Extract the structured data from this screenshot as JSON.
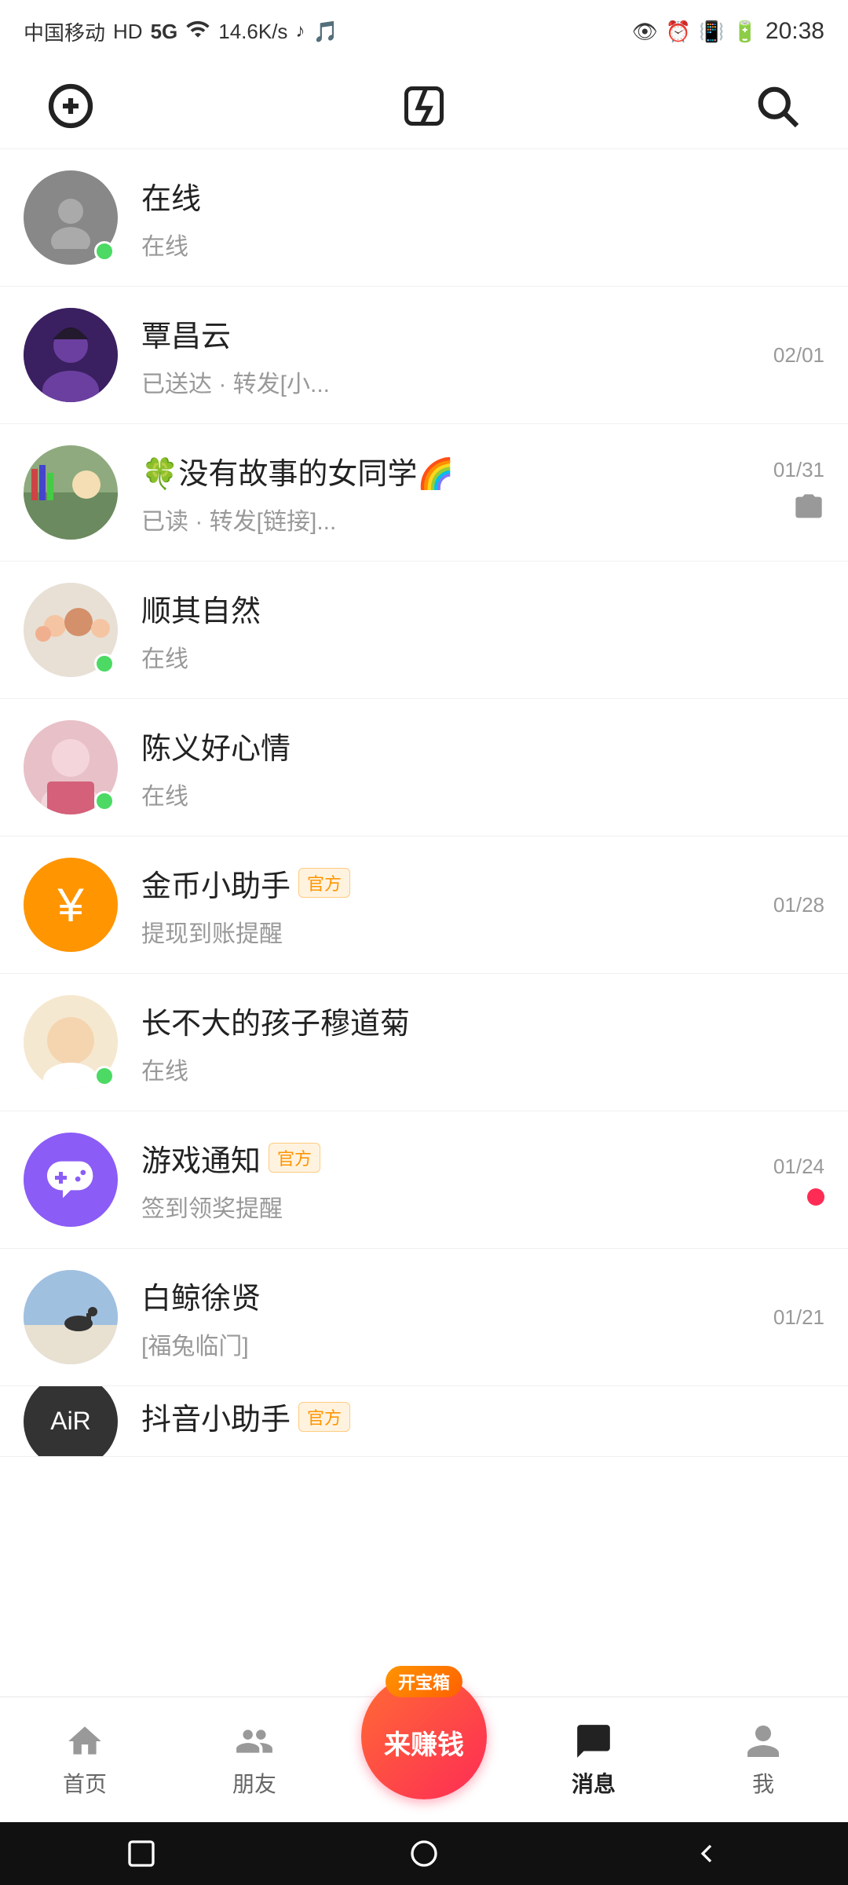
{
  "statusBar": {
    "carrier": "中国移动",
    "networkType": "HD 5G",
    "speed": "14.6K/s",
    "time": "20:38"
  },
  "topNav": {
    "addLabel": "+",
    "flashLabel": "⚡",
    "searchLabel": "🔍"
  },
  "contacts": [
    {
      "id": "contact-1",
      "name": "在线",
      "subtext": "在线",
      "time": "",
      "online": true,
      "avatarColor": "#888",
      "avatarType": "photo"
    },
    {
      "id": "contact-2",
      "name": "覃昌云",
      "subtext": "已送达 · 转发[小...",
      "time": "02/01",
      "online": false,
      "avatarColor": "#5c3d8f",
      "avatarType": "photo"
    },
    {
      "id": "contact-3",
      "name": "🍀没有故事的女同学🌈",
      "subtext": "已读 · 转发[链接]...",
      "time": "01/31",
      "online": false,
      "avatarColor": "#a8d8a8",
      "avatarType": "photo",
      "hasCamera": true
    },
    {
      "id": "contact-4",
      "name": "顺其自然",
      "subtext": "在线",
      "time": "",
      "online": true,
      "avatarColor": "#c8a0a0",
      "avatarType": "photo"
    },
    {
      "id": "contact-5",
      "name": "陈义好心情",
      "subtext": "在线",
      "time": "",
      "online": true,
      "avatarColor": "#e8b4b8",
      "avatarType": "photo"
    },
    {
      "id": "contact-6",
      "name": "金币小助手",
      "subtext": "提现到账提醒",
      "time": "01/28",
      "online": false,
      "avatarColor": "#ff9500",
      "avatarType": "yen",
      "isOfficial": true,
      "officialLabel": "官方"
    },
    {
      "id": "contact-7",
      "name": "长不大的孩子穆道菊",
      "subtext": "在线",
      "time": "",
      "online": true,
      "avatarColor": "#f5deb3",
      "avatarType": "photo"
    },
    {
      "id": "contact-8",
      "name": "游戏通知",
      "subtext": "签到领奖提醒",
      "time": "01/24",
      "online": false,
      "avatarColor": "#8b5cf6",
      "avatarType": "game",
      "isOfficial": true,
      "officialLabel": "官方",
      "hasUnread": true
    },
    {
      "id": "contact-9",
      "name": "白鲸徐贤",
      "subtext": "[福兔临门]",
      "time": "01/21",
      "online": false,
      "avatarColor": "#b0c4de",
      "avatarType": "photo"
    },
    {
      "id": "contact-10",
      "name": "抖音小助手",
      "subtext": "",
      "time": "",
      "online": false,
      "avatarColor": "#444",
      "avatarType": "photo",
      "isOfficial": true,
      "officialLabel": "官方",
      "partial": true
    }
  ],
  "bottomNav": {
    "items": [
      {
        "label": "首页",
        "active": false
      },
      {
        "label": "朋友",
        "active": false
      },
      {
        "label": "来赚钱",
        "active": false,
        "isCenter": true
      },
      {
        "label": "消息",
        "active": true
      },
      {
        "label": "我",
        "active": false
      }
    ],
    "centerBadge": "开宝箱"
  }
}
